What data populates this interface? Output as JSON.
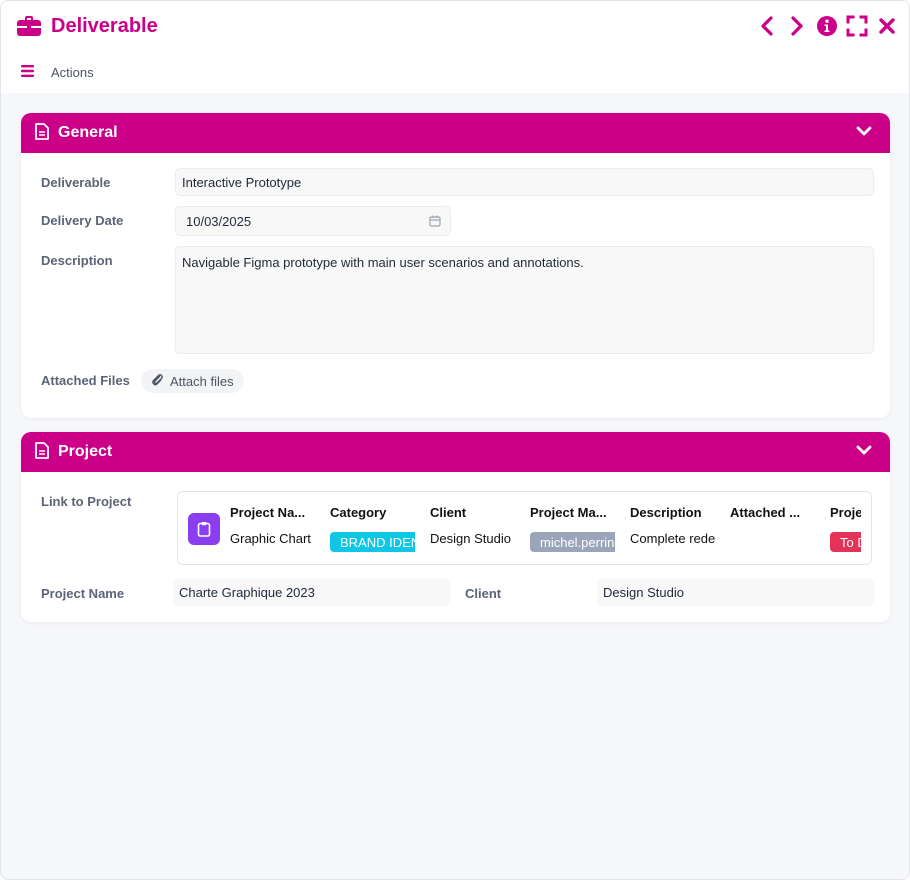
{
  "window": {
    "title": "Deliverable",
    "actions_label": "Actions",
    "accent_color": "#cc0088",
    "icons": {
      "title": "briefcase-icon",
      "prev": "chevron-left-icon",
      "next": "chevron-right-icon",
      "info": "info-icon",
      "fullscreen": "expand-icon",
      "close": "close-icon",
      "menu": "hamburger-icon"
    }
  },
  "general": {
    "header": "General",
    "deliverable_label": "Deliverable",
    "deliverable_value": "Interactive Prototype",
    "delivery_date_label": "Delivery Date",
    "delivery_date_value": "10/03/2025",
    "description_label": "Description",
    "description_value": "Navigable Figma prototype with main user scenarios and annotations.",
    "attached_files_label": "Attached Files",
    "attach_button": "Attach files"
  },
  "project": {
    "header": "Project",
    "link_label": "Link to Project",
    "columns": [
      {
        "header": "Project Na...",
        "value": "Graphic Chart"
      },
      {
        "header": "Category",
        "value": "BRAND IDENTITY",
        "chip_color": "#0fc6e6"
      },
      {
        "header": "Client",
        "value": "Design Studio"
      },
      {
        "header": "Project Ma...",
        "value": "michel.perrin",
        "chip_color": "#9aa5b9"
      },
      {
        "header": "Description",
        "value": "Complete redesign"
      },
      {
        "header": "Attached ...",
        "value": ""
      },
      {
        "header": "Project Status",
        "value": "To Do",
        "chip_color": "#e33358"
      }
    ],
    "project_name_label": "Project Name",
    "project_name_value": "Charte Graphique 2023",
    "client_label": "Client",
    "client_value": "Design Studio"
  }
}
